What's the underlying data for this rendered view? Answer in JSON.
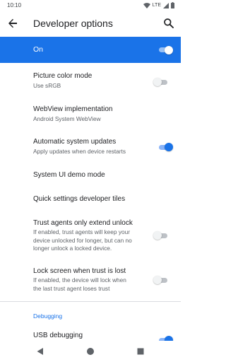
{
  "status_bar": {
    "time": "10:10",
    "network": "LTE",
    "icons": [
      "wifi-icon",
      "signal-icon",
      "battery-icon"
    ]
  },
  "app_bar": {
    "title": "Developer options",
    "icons": [
      "back-arrow-icon",
      "search-icon"
    ]
  },
  "master_switch": {
    "label": "On",
    "checked": true
  },
  "settings": {
    "picture_color_mode": {
      "title": "Picture color mode",
      "summary": "Use sRGB",
      "checked": false
    },
    "webview": {
      "title": "WebView implementation",
      "summary": "Android System WebView"
    },
    "auto_updates": {
      "title": "Automatic system updates",
      "summary": "Apply updates when device restarts",
      "checked": true
    },
    "system_ui_demo": {
      "title": "System UI demo mode"
    },
    "quick_settings_tiles": {
      "title": "Quick settings developer tiles"
    },
    "trust_agents": {
      "title": "Trust agents only extend unlock",
      "summary_lines": [
        "If enabled, trust agents will keep your",
        "device unlocked for longer, but can no",
        "longer unlock a locked device."
      ],
      "checked": false
    },
    "lock_screen_trust": {
      "title": "Lock screen when trust is lost",
      "summary_lines": [
        "If enabled, the device will lock when",
        "the last trust agent loses trust"
      ],
      "checked": false
    }
  },
  "debugging": {
    "header": "Debugging",
    "usb_debugging": {
      "title": "USB debugging",
      "checked": true
    }
  },
  "nav_bar": {
    "icons": [
      "back-triangle-icon",
      "home-circle-icon",
      "recents-square-icon"
    ]
  },
  "colors": {
    "accent": "#1a73e8",
    "accent_light": "#8ab4f8",
    "text_primary": "#202124",
    "text_secondary": "#5f6368",
    "divider": "#dadce0"
  }
}
